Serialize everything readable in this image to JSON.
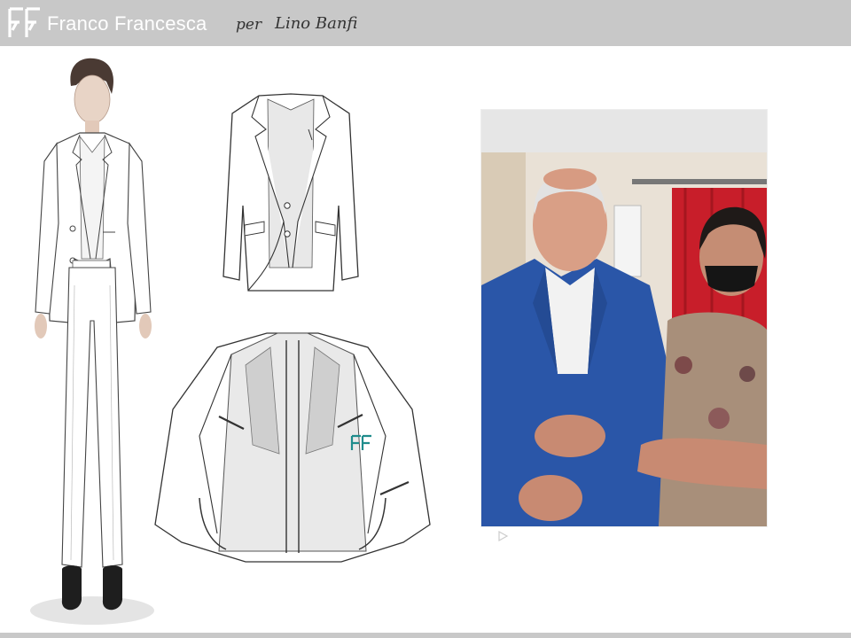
{
  "header": {
    "brand": "Franco Francesca",
    "per": "per",
    "client": "Lino Banfi"
  },
  "icons": {
    "logo": "ff-monogram-logo",
    "heart": "heart-icon",
    "play": "play-icon"
  },
  "colors": {
    "header_bg": "#c8c8c8",
    "logo_teal": "#1f8c8c",
    "jacket_blue": "#2a56a8",
    "curtain_red": "#c81e2a"
  }
}
